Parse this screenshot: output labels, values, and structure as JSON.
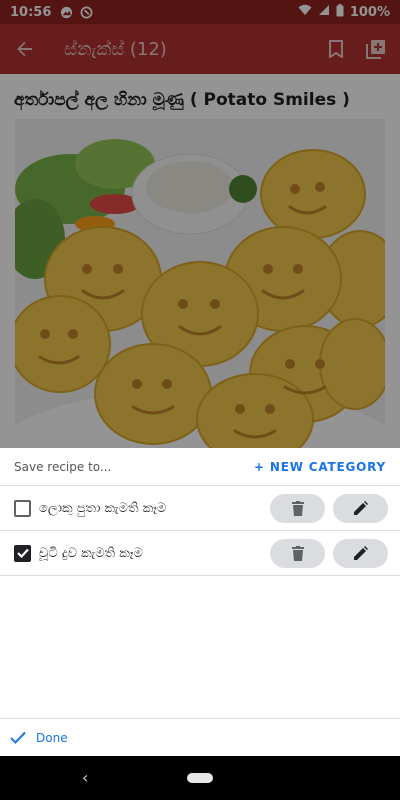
{
  "status_bar": {
    "time": "10:56",
    "battery": "100%"
  },
  "app_bar": {
    "title": "ස්නැක්ස් (12)"
  },
  "recipe": {
    "title": "අර්තාපල් අල හිනා මූණු ( Potato Smiles )"
  },
  "sheet": {
    "label": "Save recipe to...",
    "new_category": "+ NEW CATEGORY",
    "categories": [
      {
        "name": "ලොකු පුතා කැමති කෑම",
        "checked": false
      },
      {
        "name": "චූටි දුව කැමති කෑම",
        "checked": true
      }
    ],
    "done": "Done"
  },
  "icons": [
    "back-arrow-icon",
    "bookmark-icon",
    "add-to-library-icon",
    "trash-icon",
    "pencil-icon",
    "check-icon"
  ]
}
